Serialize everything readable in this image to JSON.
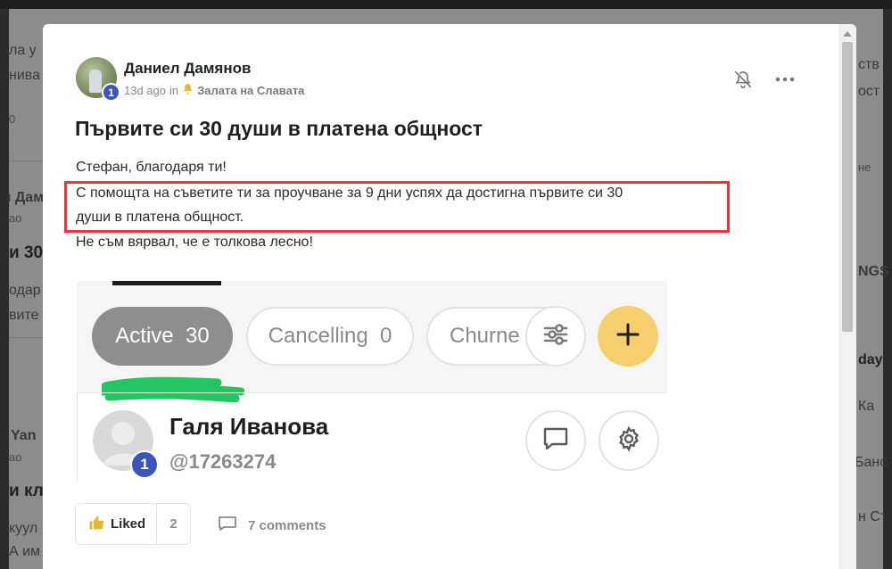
{
  "backdrop": {
    "fragments": [
      {
        "text": "ла у"
      },
      {
        "text": "нива"
      },
      {
        "text": "0"
      },
      {
        "text": "ı Дам"
      },
      {
        "text": "ао"
      },
      {
        "text": "и 30"
      },
      {
        "text": "одар"
      },
      {
        "text": "вите"
      },
      {
        "text": "Yan"
      },
      {
        "text": "ао"
      },
      {
        "text": "и кл"
      },
      {
        "text": "куул"
      },
      {
        "text": "А им"
      },
      {
        "text": "ств"
      },
      {
        "text": "ост"
      },
      {
        "text": "не"
      },
      {
        "text": "NGS"
      },
      {
        "text": "day"
      },
      {
        "text": "Ка"
      },
      {
        "text": "Банс"
      },
      {
        "text": "н Ст"
      }
    ]
  },
  "post": {
    "author": "Даниел Дамянов",
    "author_level": "1",
    "time_ago": "13d ago",
    "in_label": "in",
    "group_icon": "bell-icon",
    "group_name": "Залата на Славата",
    "title": "Първите си 30 души в платена общност",
    "body": {
      "line1": "Стефан, благодаря ти!",
      "line2": "С помощта на съветите ти за проучване за 9 дни успях да достигна първите си 30",
      "line3": "души в платена общност.",
      "line4": "Не съм вярвал, че е толкова лесно!"
    }
  },
  "embed": {
    "tabs": [
      {
        "label": "Active",
        "count": "30"
      },
      {
        "label": "Cancelling",
        "count": "0"
      },
      {
        "label": "Churne"
      }
    ],
    "filter_icon": "sliders-icon",
    "add_icon": "plus-icon",
    "member": {
      "name": "Галя Иванова",
      "handle": "@17263274",
      "level": "1"
    },
    "colors": {
      "active_tab": "#8e8e8e",
      "add_button": "#f5cf6e",
      "level_badge": "#3c55b8",
      "scribble": "#22c55e"
    }
  },
  "footer": {
    "liked_label": "Liked",
    "likes_count": "2",
    "comments_label": "7 comments"
  },
  "colors": {
    "highlight_border": "#e5373b"
  }
}
